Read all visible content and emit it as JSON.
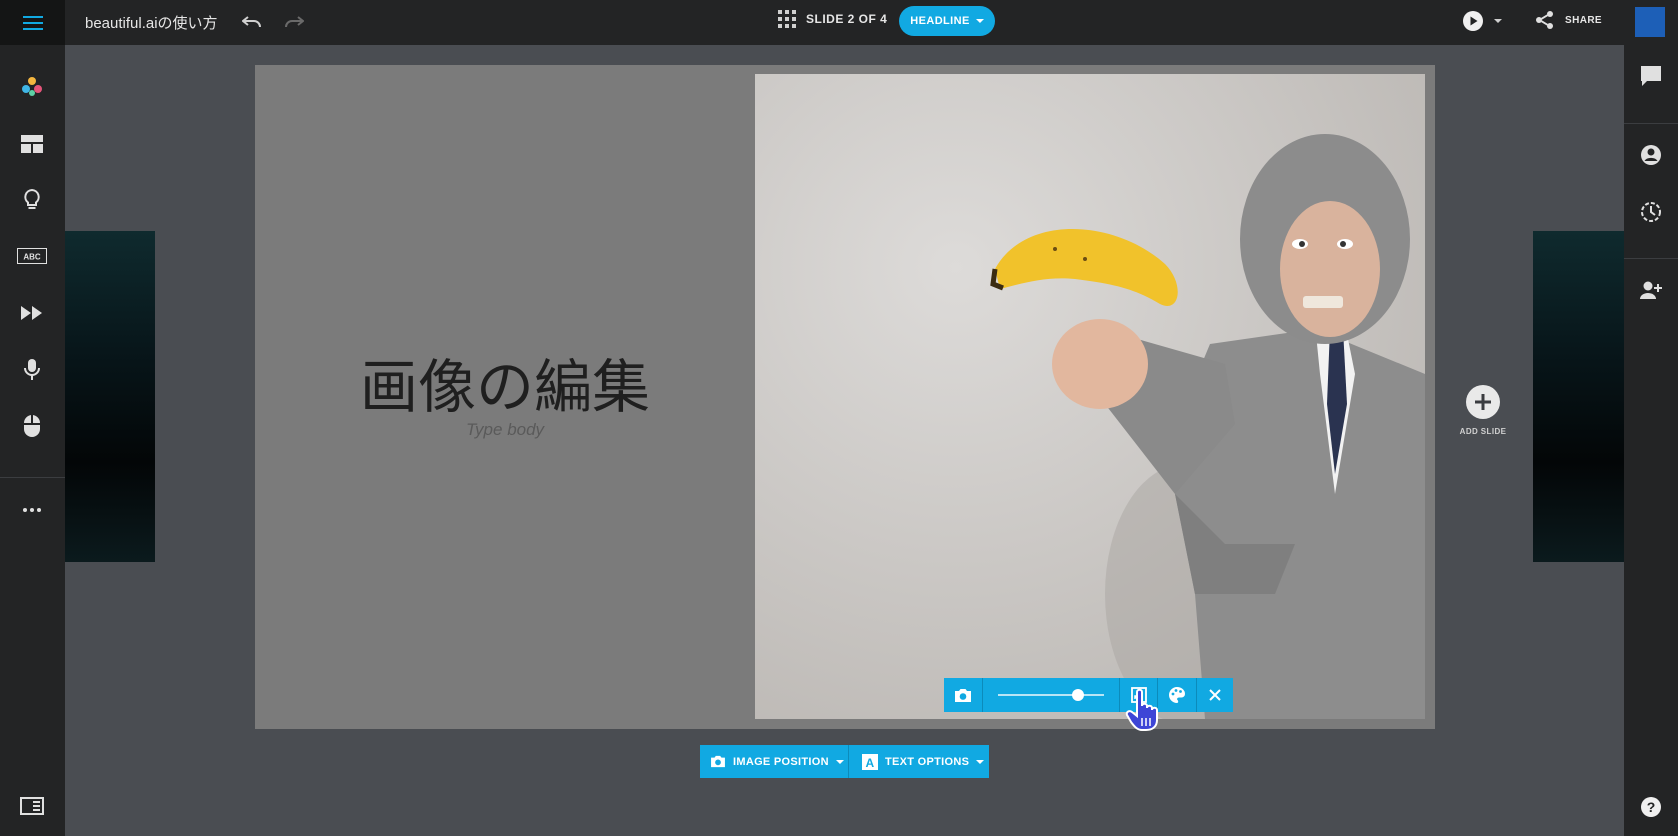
{
  "app": {
    "title": "beautiful.aiの使い方",
    "slide_counter": "SLIDE 2 OF 4",
    "headline_label": "HEADLINE",
    "share_label": "SHARE"
  },
  "slide": {
    "title": "画像の編集",
    "body_placeholder": "Type body"
  },
  "add_slide_label": "ADD SLIDE",
  "bottom_toolbar": {
    "image_position_label": "IMAGE POSITION",
    "text_options_label": "TEXT OPTIONS"
  },
  "image_toolbar": {
    "zoom_level": 0.75
  },
  "colors": {
    "accent": "#11a9e2",
    "topbar": "#232425",
    "canvas": "#4a4d52"
  },
  "icons": {
    "menu": "hamburger-icon",
    "undo": "undo-icon",
    "redo": "redo-icon",
    "grid": "grid-icon",
    "play": "play-icon",
    "share": "share-icon",
    "left_sidebar": [
      "palette-icon",
      "layout-icon",
      "lightbulb-icon",
      "abc-icon",
      "fast-forward-icon",
      "microphone-icon",
      "mouse-icon",
      "more-icon"
    ],
    "right_sidebar": [
      "comment-icon",
      "user-icon",
      "history-icon",
      "add-user-icon"
    ]
  }
}
